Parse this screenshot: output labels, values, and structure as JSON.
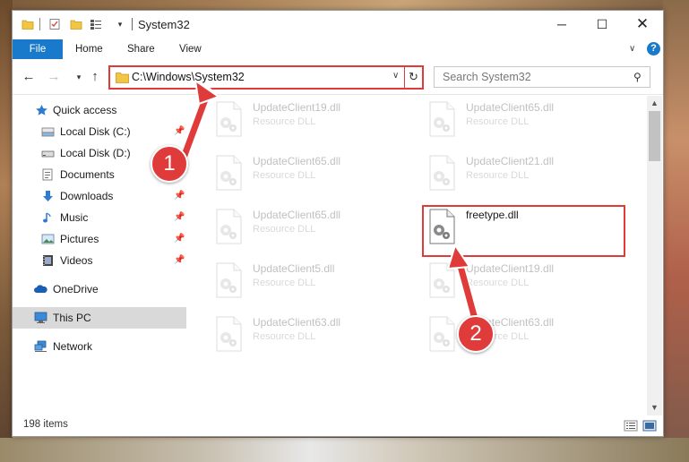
{
  "window": {
    "title": "System32",
    "controls": {
      "minimize": "─",
      "maximize": "☐",
      "close": "✕"
    }
  },
  "ribbon": {
    "tabs": [
      "File",
      "Home",
      "Share",
      "View"
    ],
    "expand_glyph": "∨",
    "help_glyph": "?"
  },
  "nav": {
    "back_glyph": "←",
    "forward_glyph": "→",
    "recent_glyph": "▾",
    "up_glyph": "↑",
    "address": "C:\\Windows\\System32",
    "address_dropdown_glyph": "∨",
    "refresh_glyph": "↻",
    "search_placeholder": "Search System32",
    "search_glyph": "⚲"
  },
  "sidebar": {
    "items": [
      {
        "label": "Quick access",
        "icon": "star-icon",
        "pinned": false
      },
      {
        "label": "Local Disk (C:)",
        "icon": "drive-icon",
        "pinned": true
      },
      {
        "label": "Local Disk (D:)",
        "icon": "drive-icon",
        "pinned": true
      },
      {
        "label": "Documents",
        "icon": "documents-icon",
        "pinned": true
      },
      {
        "label": "Downloads",
        "icon": "download-icon",
        "pinned": true
      },
      {
        "label": "Music",
        "icon": "music-icon",
        "pinned": true
      },
      {
        "label": "Pictures",
        "icon": "pictures-icon",
        "pinned": true
      },
      {
        "label": "Videos",
        "icon": "videos-icon",
        "pinned": true
      },
      {
        "label": "OneDrive",
        "icon": "cloud-icon",
        "pinned": false
      },
      {
        "label": "This PC",
        "icon": "computer-icon",
        "pinned": false,
        "selected": true
      },
      {
        "label": "Network",
        "icon": "network-icon",
        "pinned": false
      }
    ],
    "pin_glyph": "📌"
  },
  "files": [
    {
      "name": "UpdateClient19.dll",
      "type": "Resource DLL",
      "faded": true
    },
    {
      "name": "UpdateClient65.dll",
      "type": "Resource DLL",
      "faded": true
    },
    {
      "name": "UpdateClient65.dll",
      "type": "Resource DLL",
      "faded": true
    },
    {
      "name": "UpdateClient21.dll",
      "type": "Resource DLL",
      "faded": true
    },
    {
      "name": "UpdateClient65.dll",
      "type": "Resource DLL",
      "faded": true
    },
    {
      "name": "freetype.dll",
      "type": "",
      "faded": false,
      "highlighted": true
    },
    {
      "name": "UpdateClient5.dll",
      "type": "Resource DLL",
      "faded": true
    },
    {
      "name": "UpdateClient19.dll",
      "type": "Resource DLL",
      "faded": true
    },
    {
      "name": "UpdateClient63.dll",
      "type": "Resource DLL",
      "faded": true
    },
    {
      "name": "UpdateClient63.dll",
      "type": "Resource DLL",
      "faded": true
    }
  ],
  "status": {
    "item_count": "198 items"
  },
  "callouts": [
    "1",
    "2"
  ],
  "colors": {
    "accent": "#1979ca",
    "annotation_red": "#e03b3b",
    "folder_yellow": "#f3c545"
  }
}
